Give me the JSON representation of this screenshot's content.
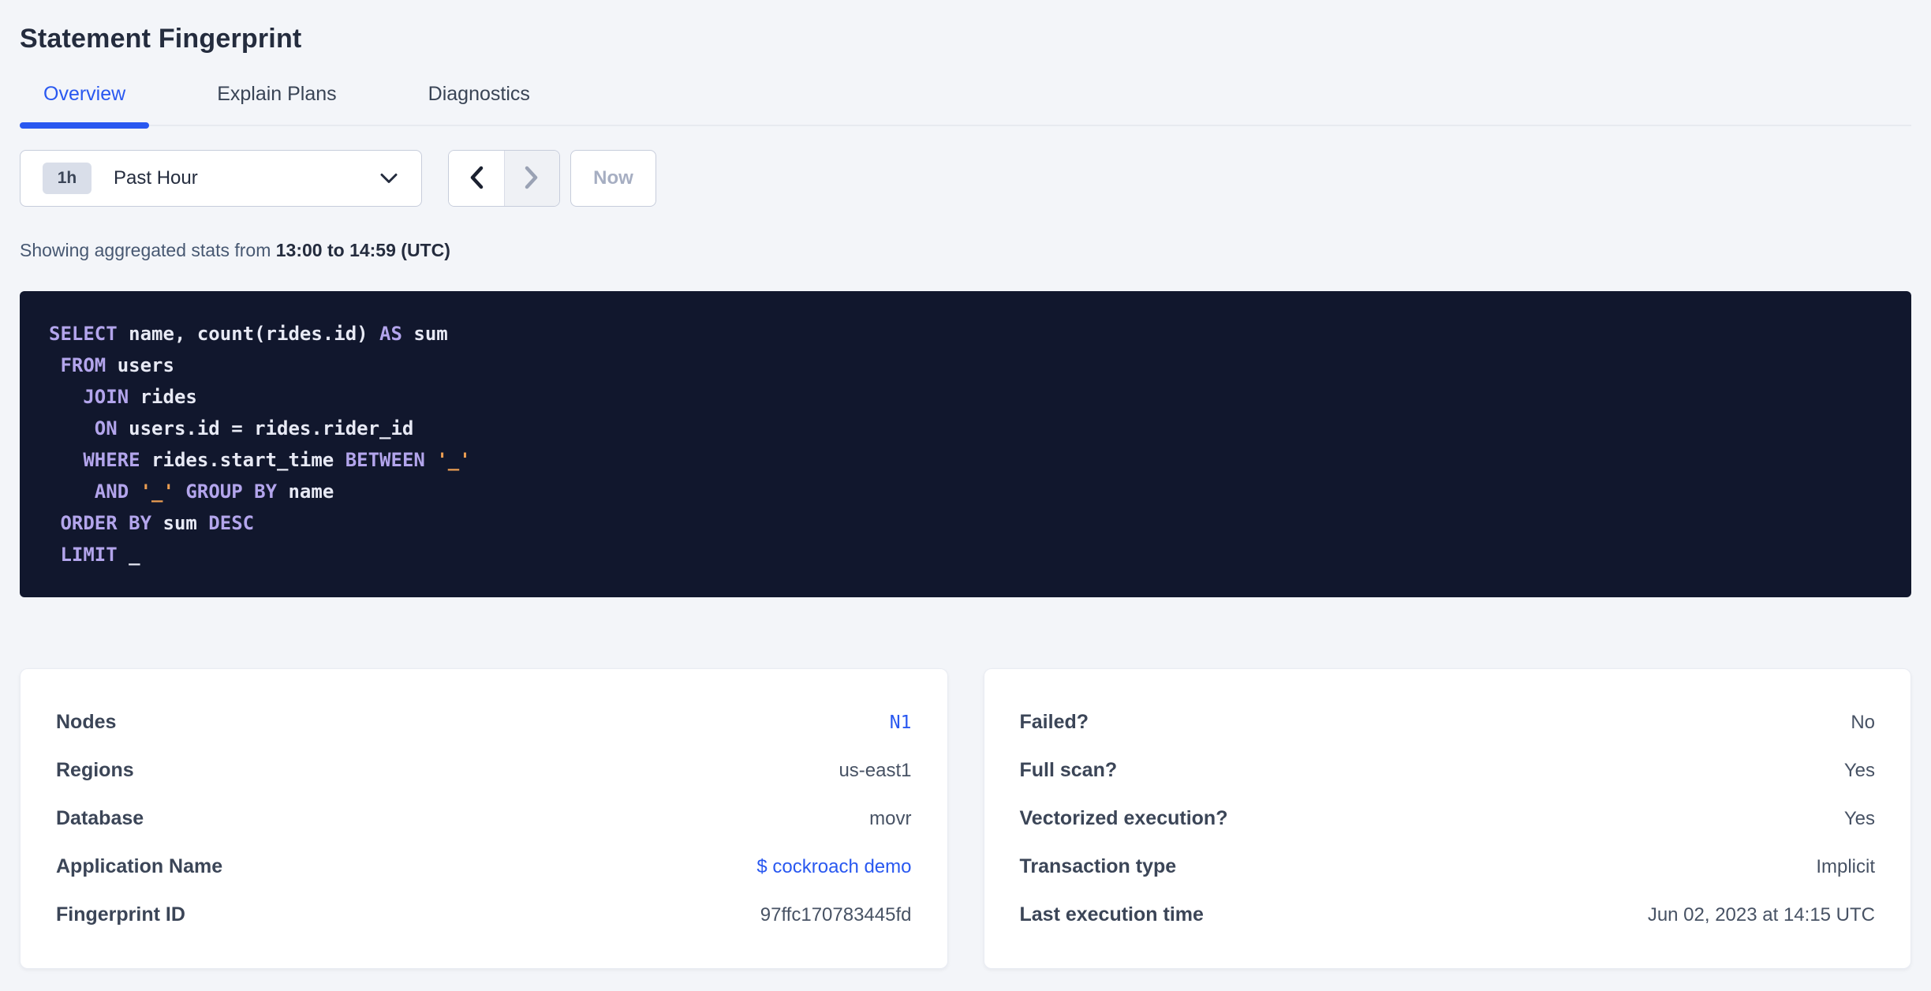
{
  "colors": {
    "accent": "#2958f0",
    "code_bg": "#11172d",
    "code_keyword": "#b3a5ec",
    "code_plain": "#e7e9f4",
    "code_string": "#ec9e52"
  },
  "page": {
    "title": "Statement Fingerprint"
  },
  "tabs": [
    {
      "label": "Overview",
      "active": true
    },
    {
      "label": "Explain Plans",
      "active": false
    },
    {
      "label": "Diagnostics",
      "active": false
    }
  ],
  "time_controls": {
    "range_badge": "1h",
    "range_label": "Past Hour",
    "now_label": "Now"
  },
  "stats_line": {
    "prefix": "Showing aggregated stats from ",
    "range": "13:00 to 14:59 (UTC)"
  },
  "sql": {
    "lines": [
      [
        {
          "t": "SELECT",
          "c": "kw"
        },
        {
          "t": " name, count(rides.id) ",
          "c": "pl"
        },
        {
          "t": "AS",
          "c": "kw"
        },
        {
          "t": " sum",
          "c": "pl"
        }
      ],
      [
        {
          "t": " ",
          "c": "pl"
        },
        {
          "t": "FROM",
          "c": "kw"
        },
        {
          "t": " users",
          "c": "pl"
        }
      ],
      [
        {
          "t": "   ",
          "c": "pl"
        },
        {
          "t": "JOIN",
          "c": "kw"
        },
        {
          "t": " rides",
          "c": "pl"
        }
      ],
      [
        {
          "t": "    ",
          "c": "pl"
        },
        {
          "t": "ON",
          "c": "kw"
        },
        {
          "t": " users.id = rides.rider_id",
          "c": "pl"
        }
      ],
      [
        {
          "t": "   ",
          "c": "pl"
        },
        {
          "t": "WHERE",
          "c": "kw"
        },
        {
          "t": " rides.start_time ",
          "c": "pl"
        },
        {
          "t": "BETWEEN",
          "c": "kw"
        },
        {
          "t": " ",
          "c": "pl"
        },
        {
          "t": "'_'",
          "c": "str"
        }
      ],
      [
        {
          "t": "    ",
          "c": "pl"
        },
        {
          "t": "AND",
          "c": "kw"
        },
        {
          "t": " ",
          "c": "pl"
        },
        {
          "t": "'_'",
          "c": "str"
        },
        {
          "t": " ",
          "c": "pl"
        },
        {
          "t": "GROUP BY",
          "c": "kw"
        },
        {
          "t": " name",
          "c": "pl"
        }
      ],
      [
        {
          "t": " ",
          "c": "pl"
        },
        {
          "t": "ORDER BY",
          "c": "kw"
        },
        {
          "t": " sum ",
          "c": "pl"
        },
        {
          "t": "DESC",
          "c": "kw"
        }
      ],
      [
        {
          "t": " ",
          "c": "pl"
        },
        {
          "t": "LIMIT",
          "c": "kw"
        },
        {
          "t": " _",
          "c": "pl"
        }
      ]
    ]
  },
  "cards": {
    "left": {
      "rows": [
        {
          "label": "Nodes",
          "value": "N1",
          "style": "link-mono",
          "interactable": true
        },
        {
          "label": "Regions",
          "value": "us-east1",
          "style": "plain",
          "interactable": false
        },
        {
          "label": "Database",
          "value": "movr",
          "style": "plain",
          "interactable": false
        },
        {
          "label": "Application Name",
          "value": "$ cockroach demo",
          "style": "link",
          "interactable": true
        },
        {
          "label": "Fingerprint ID",
          "value": "97ffc170783445fd",
          "style": "plain",
          "interactable": false
        }
      ]
    },
    "right": {
      "rows": [
        {
          "label": "Failed?",
          "value": "No",
          "style": "plain",
          "interactable": false
        },
        {
          "label": "Full scan?",
          "value": "Yes",
          "style": "plain",
          "interactable": false
        },
        {
          "label": "Vectorized execution?",
          "value": "Yes",
          "style": "plain",
          "interactable": false
        },
        {
          "label": "Transaction type",
          "value": "Implicit",
          "style": "plain",
          "interactable": false
        },
        {
          "label": "Last execution time",
          "value": "Jun 02, 2023 at 14:15 UTC",
          "style": "plain",
          "interactable": false
        }
      ]
    }
  }
}
